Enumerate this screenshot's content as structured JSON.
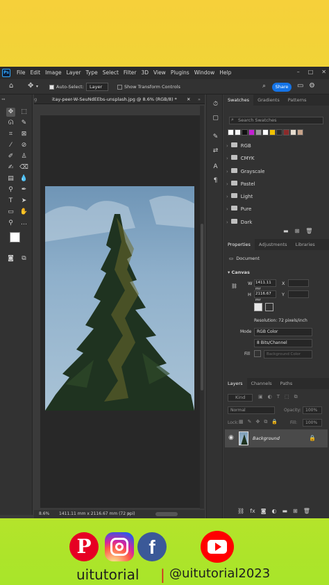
{
  "app": {
    "menus": [
      "File",
      "Edit",
      "Image",
      "Layer",
      "Type",
      "Select",
      "Filter",
      "3D",
      "View",
      "Plugins",
      "Window",
      "Help"
    ],
    "window_buttons": [
      "–",
      "□",
      "✕"
    ]
  },
  "options": {
    "auto_select_label": "Auto-Select:",
    "auto_select_value": "Layer",
    "show_transform_label": "Show Transform Controls",
    "share_label": "Share"
  },
  "document": {
    "tab_label": "itay-peer-W-SeuNdEEbs-unsplash.jpg @ 8.6% (RGB/8) *",
    "tab_prefix": "g",
    "zoom": "8.6%",
    "dimensions": "1411.11 mm x 2116.67 mm (72 ppi)"
  },
  "swatches_panel": {
    "tabs": [
      "Swatches",
      "Gradients",
      "Patterns"
    ],
    "search_placeholder": "Search Swatches",
    "colors": [
      "#ffffff",
      "#f5f5f5",
      "#111111",
      "#c21fd2",
      "#9a9a9a",
      "#ffffff",
      "#f2c200",
      "#2a2a2a",
      "#8b2a2a",
      "#e6dccf",
      "#c7a38a"
    ],
    "groups": [
      "RGB",
      "CMYK",
      "Grayscale",
      "Pastel",
      "Light",
      "Pure",
      "Dark"
    ]
  },
  "properties_panel": {
    "tabs": [
      "Properties",
      "Adjustments",
      "Libraries"
    ],
    "doc_label": "Document",
    "canvas_label": "Canvas",
    "w_label": "W",
    "w_value": "1411.11 mr",
    "x_label": "X",
    "h_label": "H",
    "h_value": "2116.67 mr",
    "y_label": "Y",
    "resolution": "Resolution: 72 pixels/inch",
    "mode_label": "Mode",
    "mode_value": "RGB Color",
    "depth_value": "8 Bits/Channel",
    "fill_label": "Fill",
    "fill_value": "Background Color"
  },
  "layers_panel": {
    "tabs": [
      "Layers",
      "Channels",
      "Paths"
    ],
    "kind_label": "Kind",
    "blend_mode": "Normal",
    "opacity_label": "Opacity:",
    "opacity_value": "100%",
    "lock_label": "Lock:",
    "fill_label": "Fill:",
    "fill_value": "100%",
    "layer_name": "Background"
  },
  "branding": {
    "channel_name": "uitutorial",
    "handle": "@uitutorial2023",
    "icons": [
      "pinterest-icon",
      "instagram-icon",
      "facebook-icon",
      "youtube-icon"
    ],
    "colors": {
      "pinterest": "#e60023",
      "instagram": "#d6249f",
      "facebook": "#3b5998",
      "youtube": "#ff0000"
    }
  }
}
